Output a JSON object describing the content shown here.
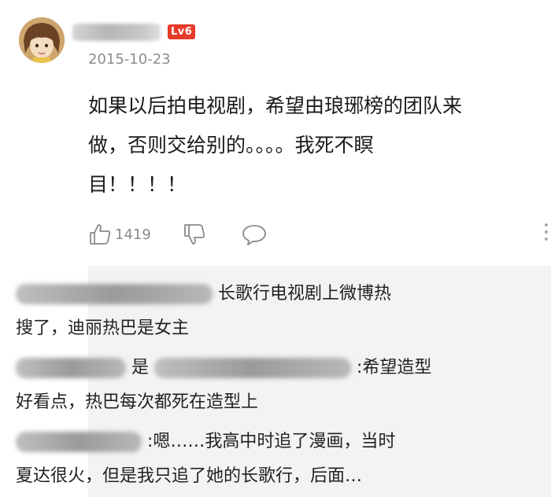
{
  "post": {
    "avatar_icon": "avatar-image",
    "level_badge": "Lv6",
    "date": "2015-10-23",
    "body_lines": [
      "如果以后拍电视剧，希望由琅琊榜的团队来",
      "做，否则交给别的。。。。我死不瞑",
      "目！！！！"
    ],
    "like_count": "1419"
  },
  "actions": {
    "like_icon": "thumbs-up-icon",
    "dislike_icon": "thumbs-down-icon",
    "comment_icon": "comment-bubble-icon"
  },
  "replies": [
    {
      "line1": "长歌行电视剧上微博热",
      "line2": "搜了，迪丽热巴是女主"
    },
    {
      "line1_mid": "是",
      "line1_end": ":希望造型",
      "line2": "好看点，热巴每次都死在造型上"
    },
    {
      "line1": ":嗯……我高中时追了漫画，当时",
      "line2": "夏达很火，但是我只追了她的长歌行，后面…"
    }
  ],
  "colors": {
    "badge_red": "#e83a2a",
    "reply_bg": "#f3f3f3",
    "meta_gray": "#8c8c8c"
  }
}
